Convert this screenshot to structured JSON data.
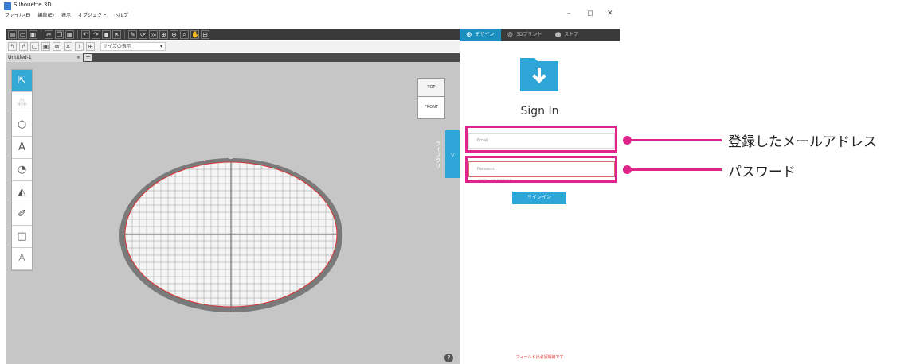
{
  "window": {
    "title": "Silhouette 3D",
    "menu": [
      "ファイル(E)",
      "編集(E)",
      "表示",
      "オブジェクト",
      "ヘルプ"
    ],
    "controls": {
      "minimize": "–",
      "maximize": "◻",
      "close": "✕"
    }
  },
  "toolbar": {
    "size_select": "サイズの表示"
  },
  "tabs": {
    "document": "Untitled-1",
    "close": "×",
    "add": "+"
  },
  "viewport": {
    "viewcube_top": "TOP",
    "viewcube_front": "FRONT",
    "library_label": "ライブラリ",
    "library_arrow": "＞",
    "help": "?"
  },
  "panel": {
    "tabs": [
      "デザイン",
      "3Dプリント",
      "ストア"
    ],
    "title": "Sign In",
    "email_placeholder": "Email",
    "password_placeholder": "Password",
    "password_hint": "パスワードをお忘れの方",
    "signin_button": "サインイン",
    "required_note": "フィールドは必須項目です"
  },
  "annotations": {
    "email_label": "登録したメールアドレス",
    "password_label": "パスワード"
  },
  "colors": {
    "accent": "#2ea6d8",
    "highlight": "#e0248c",
    "viewport_bg": "#c6c6c6"
  }
}
